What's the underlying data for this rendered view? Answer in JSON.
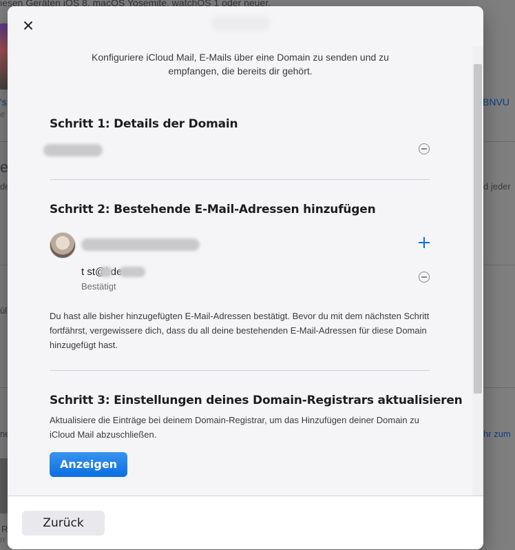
{
  "background": {
    "top_line": "iesen Geräten iOS 8, macOS Yosemite, watchOS 1 oder neuer.",
    "frag_left_1": "'s",
    "frag_left_2": "e 1",
    "frag_right_1": "BNVU",
    "frag_left_3": "e",
    "frag_left_4": "de",
    "frag_right_2": "d jeder",
    "frag_left_5": "ül",
    "frag_left_6": "ne",
    "frag_right_3": "hr zum",
    "frag_left_7": "R",
    "frag_left_8": "rr"
  },
  "modal": {
    "intro": "Konfiguriere iCloud Mail, E-Mails über eine Domain zu senden und zu empfangen, die bereits dir gehört.",
    "step1": {
      "title": "Schritt 1: Details der Domain"
    },
    "step2": {
      "title": "Schritt 2: Bestehende E-Mail-Adressen hinzufügen",
      "email": "t  st@l        de",
      "email_status": "Bestätigt",
      "note": "Du hast alle bisher hinzugefügten E-Mail-Adressen bestätigt. Bevor du mit dem nächsten Schritt fortfährst, vergewissere dich, dass du all deine bestehenden E-Mail-Adressen für diese Domain hinzugefügt hast."
    },
    "step3": {
      "title": "Schritt 3: Einstellungen deines Domain-Registrars aktualisieren",
      "description": "Aktualisiere die Einträge bei deinem Domain-Registrar, um das Hinzufügen deiner Domain zu iCloud Mail abzuschließen.",
      "button_label": "Anzeigen"
    },
    "footer": {
      "back_label": "Zurück"
    }
  },
  "colors": {
    "accent": "#0071e3",
    "modal_bg": "#f5f5f7"
  }
}
